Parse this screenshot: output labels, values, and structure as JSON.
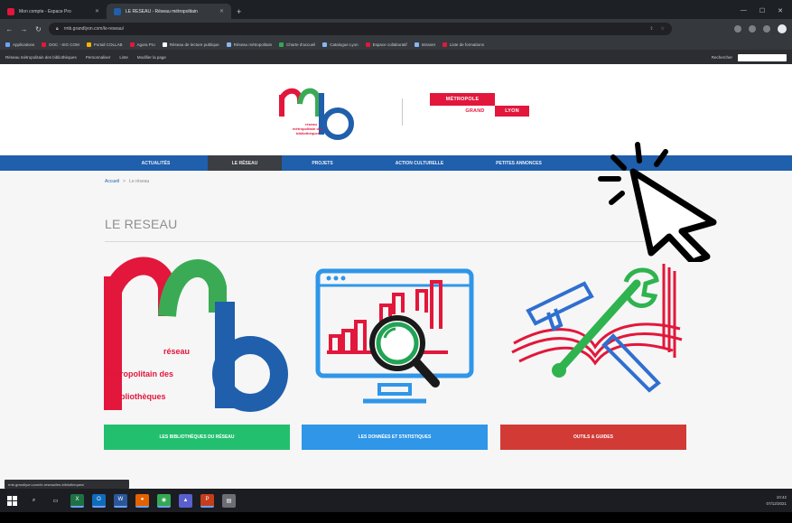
{
  "browser": {
    "tabs": [
      {
        "label": "Mon compte - Espace Pro",
        "favicon_color": "#e2173b",
        "active": false
      },
      {
        "label": "LE RESEAU - Réseau métropolitain",
        "favicon_color": "#1f5fac",
        "active": true
      }
    ],
    "new_tab_icon": "plus-icon",
    "address": "rmb.grandlyon.com/le-reseau/",
    "bookmarks": [
      {
        "label": "Applications",
        "color": "#6aa3f8"
      },
      {
        "label": "DOC - SIG COM",
        "color": "#e2173b"
      },
      {
        "label": "Portail COLLAB",
        "color": "#f4b400"
      },
      {
        "label": "Agora Pro",
        "color": "#e2173b"
      },
      {
        "label": "Réseau de lecture publique",
        "color": "#ffffff"
      },
      {
        "label": "Réseau métropolitain",
        "color": "#8ab4f8"
      },
      {
        "label": "Charte d'accueil",
        "color": "#34a853"
      },
      {
        "label": "Catalogue Lyon",
        "color": "#8ab4f8"
      },
      {
        "label": "Espace collaboratif",
        "color": "#e2173b"
      },
      {
        "label": "Intranet",
        "color": "#8ab4f8"
      },
      {
        "label": "Liste de formations",
        "color": "#e2173b"
      }
    ],
    "toolbar2": {
      "left_items": [
        "Réseau métropolitain des bibliothèques",
        "Personnaliser",
        "Liste",
        "Modifier la page"
      ],
      "right_label": "Rechercher"
    }
  },
  "site": {
    "logo_letters": [
      "m",
      "b"
    ],
    "logo_small_text": [
      "réseau",
      "métropolitain des",
      "bibliothèques"
    ],
    "partner_logo": [
      "MÉTROPOLE",
      "GRAND",
      "LYON"
    ],
    "nav": [
      {
        "label": "Actualités",
        "active": false
      },
      {
        "label": "Le réseau",
        "active": true
      },
      {
        "label": "Projets",
        "active": false
      },
      {
        "label": "Action culturelle",
        "active": false
      },
      {
        "label": "Petites annonces",
        "active": false
      }
    ],
    "breadcrumb": [
      "Accueil",
      ">",
      "Le réseau"
    ],
    "page_title": "LE RESEAU",
    "card1_logo_text": [
      "réseau",
      "métropolitain des",
      "bibliothèques"
    ],
    "cards": [
      {
        "label": "Les bibliothèques du réseau",
        "color": "#22c06e"
      },
      {
        "label": "Les données et statistiques",
        "color": "#2f96e8"
      },
      {
        "label": "Outils & guides",
        "color": "#d23a36"
      }
    ]
  },
  "status": {
    "link_preview": "rmb.grandlyon.com/le-reseau/les-bibliotheques/"
  },
  "taskbar": {
    "icons": [
      "windows-icon",
      "search-icon",
      "task-view-icon",
      "excel-icon",
      "outlook-icon",
      "word-icon",
      "firefox-icon",
      "chrome-icon",
      "photos-icon",
      "powerpoint-icon",
      "files-icon"
    ],
    "clock": "10:42",
    "date": "07/12/2021"
  },
  "colors": {
    "brand_red": "#e2173b",
    "brand_green": "#3aab54",
    "brand_blue": "#1f5fac",
    "nav_blue": "#1f5fac"
  }
}
